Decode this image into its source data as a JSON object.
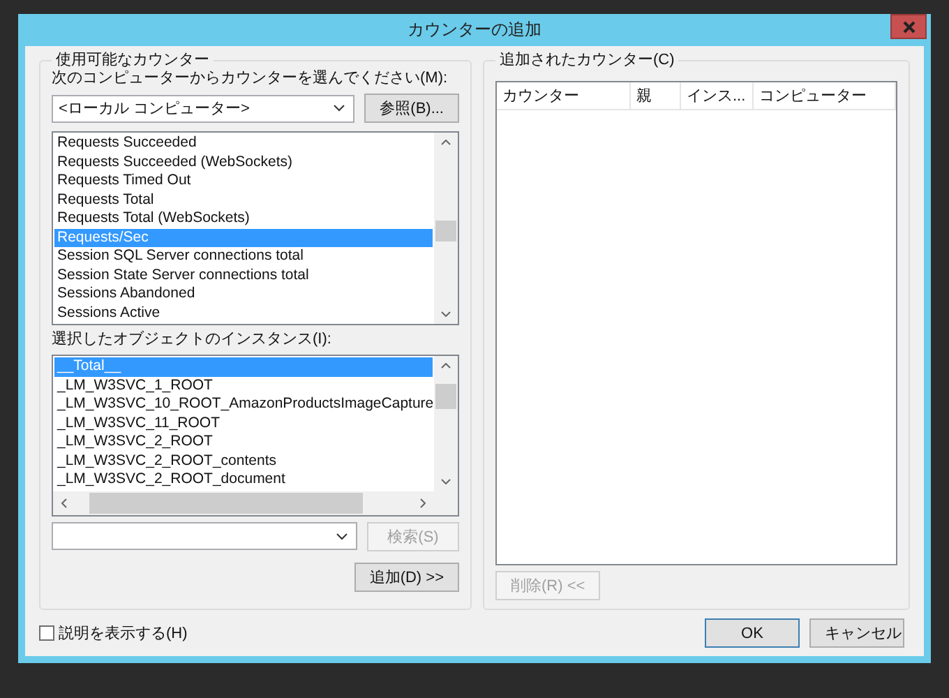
{
  "window": {
    "title": "カウンターの追加"
  },
  "available_counters": {
    "title": "使用可能なカウンター",
    "computer_label": "次のコンピューターからカウンターを選んでください(M):",
    "computer_value": "<ローカル コンピューター>",
    "browse_button": "参照(B)...",
    "counters": [
      {
        "label": "Requests Succeeded",
        "selected": false
      },
      {
        "label": "Requests Succeeded (WebSockets)",
        "selected": false
      },
      {
        "label": "Requests Timed Out",
        "selected": false
      },
      {
        "label": "Requests Total",
        "selected": false
      },
      {
        "label": "Requests Total (WebSockets)",
        "selected": false
      },
      {
        "label": "Requests/Sec",
        "selected": true
      },
      {
        "label": "Session SQL Server connections total",
        "selected": false
      },
      {
        "label": "Session State Server connections total",
        "selected": false
      },
      {
        "label": "Sessions Abandoned",
        "selected": false
      },
      {
        "label": "Sessions Active",
        "selected": false
      }
    ],
    "instances_label": "選択したオブジェクトのインスタンス(I):",
    "instances": [
      {
        "label": "__Total__",
        "selected": true
      },
      {
        "label": "_LM_W3SVC_1_ROOT",
        "selected": false
      },
      {
        "label": "_LM_W3SVC_10_ROOT_AmazonProductsImageCapture",
        "selected": false
      },
      {
        "label": "_LM_W3SVC_11_ROOT",
        "selected": false
      },
      {
        "label": "_LM_W3SVC_2_ROOT",
        "selected": false
      },
      {
        "label": "_LM_W3SVC_2_ROOT_contents",
        "selected": false
      },
      {
        "label": "_LM_W3SVC_2_ROOT_document",
        "selected": false
      }
    ],
    "search_button": {
      "label": "検索(S)",
      "disabled": true
    },
    "add_button": {
      "label": "追加(D) >>",
      "disabled": false
    }
  },
  "added_counters": {
    "title": "追加されたカウンター(C)",
    "columns": [
      "カウンター",
      "親",
      "インス...",
      "コンピューター"
    ],
    "remove_button": {
      "label": "削除(R) <<",
      "disabled": true
    }
  },
  "show_description": {
    "label": "説明を表示する(H)",
    "checked": false
  },
  "buttons": [
    {
      "label": "OK",
      "default": true
    },
    {
      "label": "キャンセル",
      "default": false
    }
  ]
}
